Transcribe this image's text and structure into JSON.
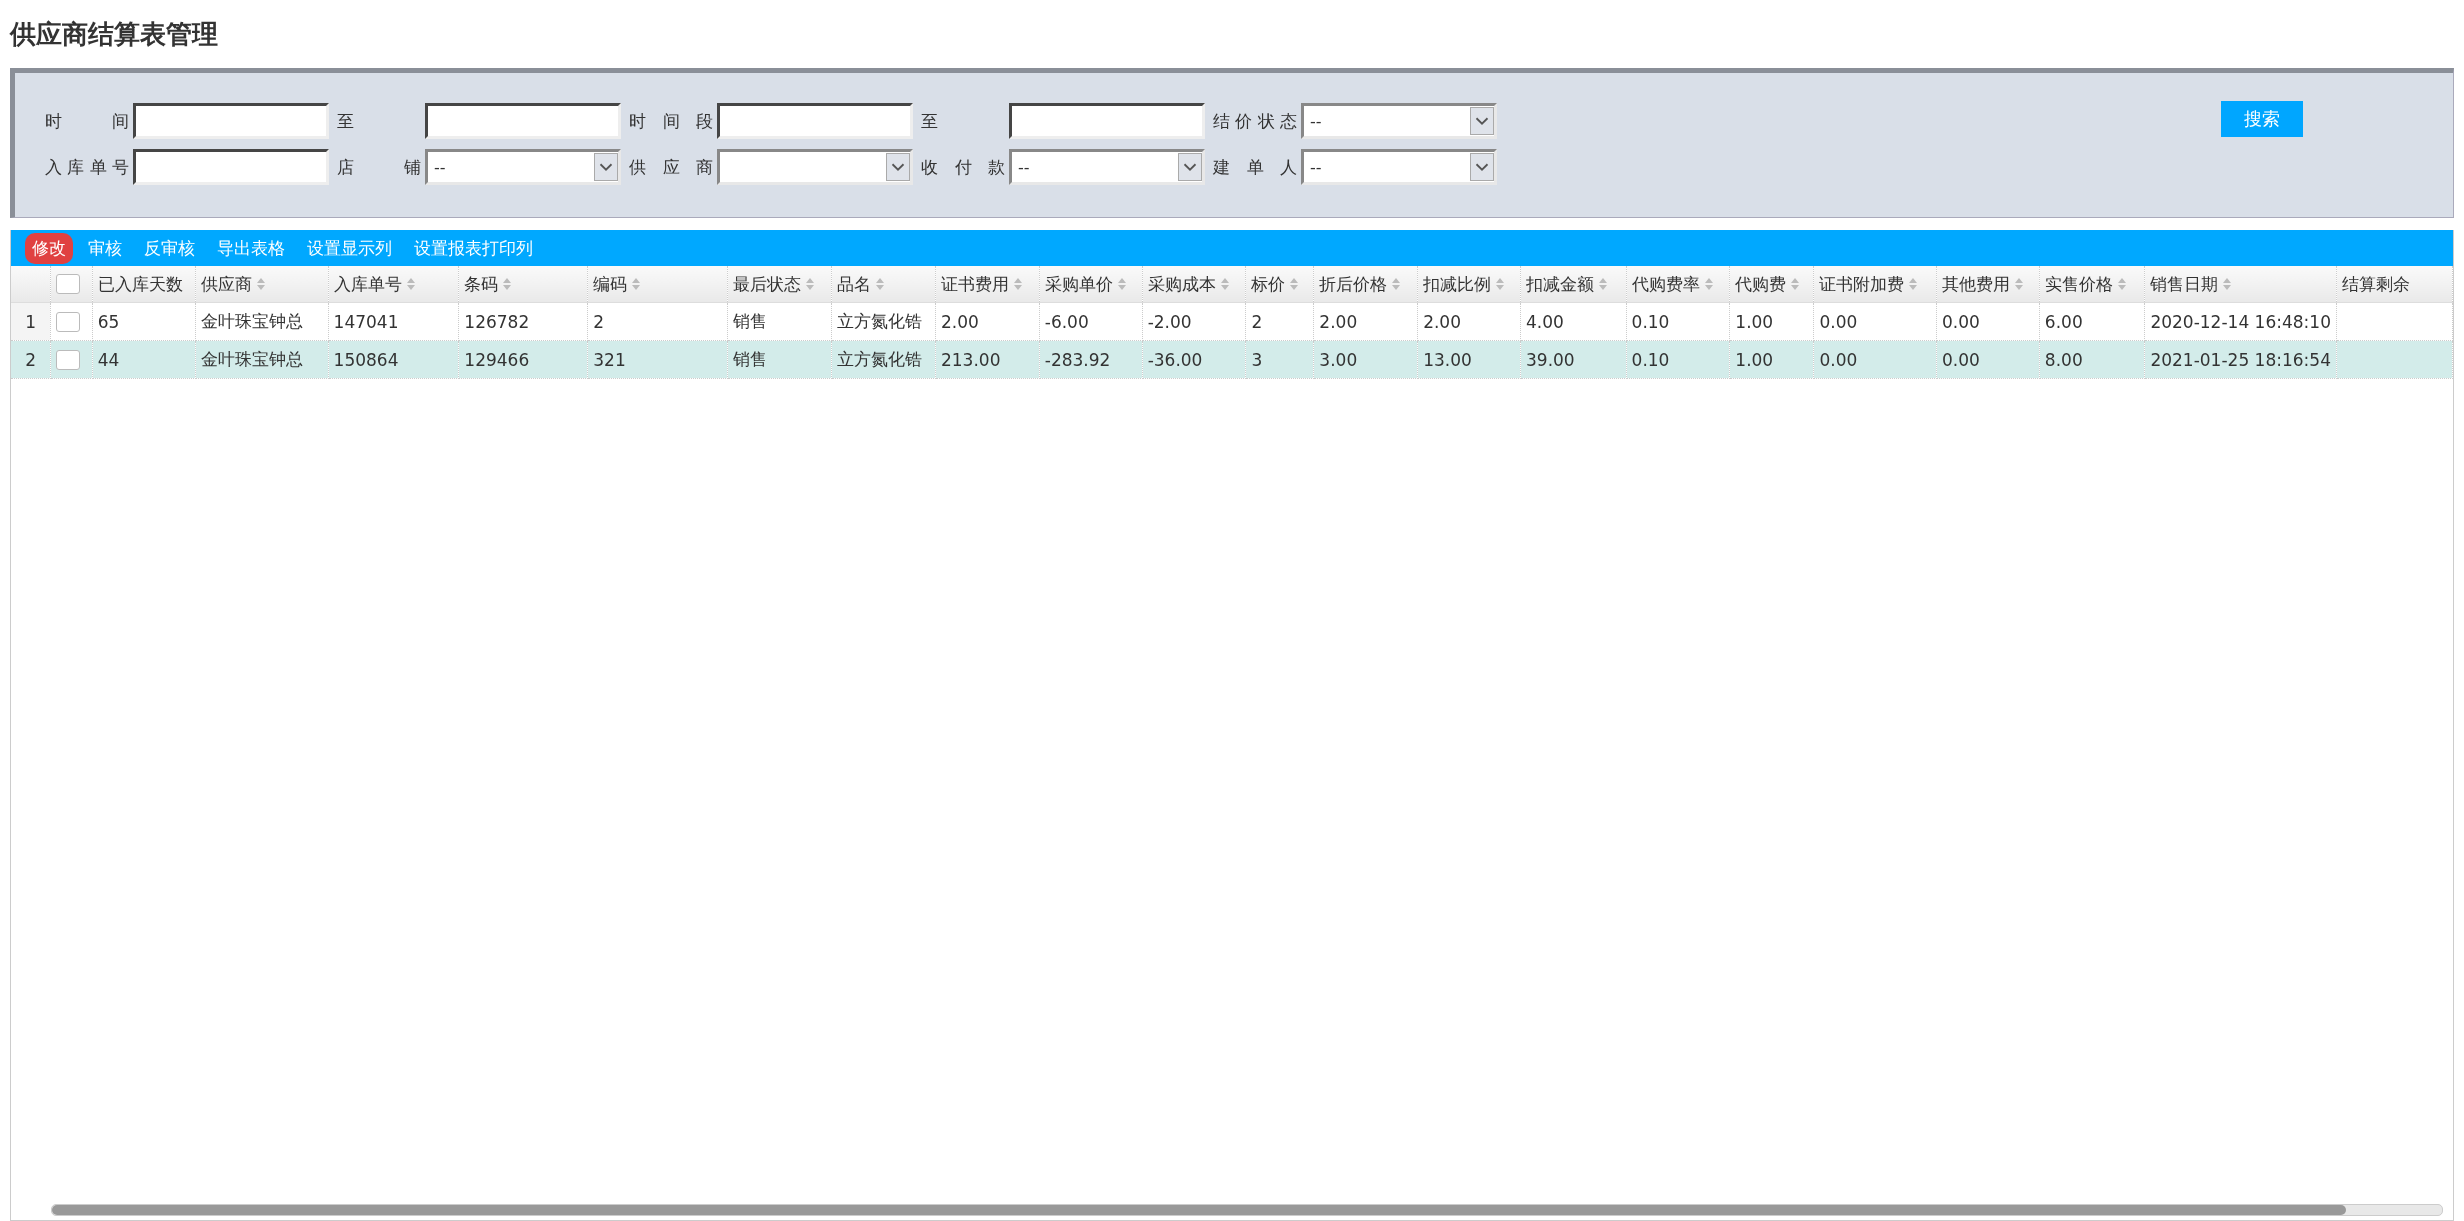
{
  "title": "供应商结算表管理",
  "filter_rows": [
    {
      "fields": [
        {
          "label": "时间",
          "kind": "input"
        },
        {
          "label": "至",
          "kind": "input"
        },
        {
          "label": "时间段",
          "kind": "input"
        },
        {
          "label": "至",
          "kind": "input"
        },
        {
          "label": "结价状态",
          "kind": "select",
          "value": "--"
        }
      ]
    },
    {
      "fields": [
        {
          "label": "入库单号",
          "kind": "input"
        },
        {
          "label": "店铺",
          "kind": "select",
          "value": "--"
        },
        {
          "label": "供应商",
          "kind": "select"
        },
        {
          "label": "收付款",
          "kind": "select",
          "value": "--"
        },
        {
          "label": "建单人",
          "kind": "select",
          "value": "--"
        }
      ]
    }
  ],
  "search_button": "搜索",
  "toolbar": [
    {
      "label": "修改",
      "selected": true
    },
    {
      "label": "审核",
      "selected": false
    },
    {
      "label": "反审核",
      "selected": false
    },
    {
      "label": "导出表格",
      "selected": false
    },
    {
      "label": "设置显示列",
      "selected": false
    },
    {
      "label": "设置报表打印列",
      "selected": false
    }
  ],
  "table": {
    "all_checked": false,
    "columns": [
      {
        "label": "已入库天数",
        "sortable": false
      },
      {
        "label": "供应商",
        "sortable": true
      },
      {
        "label": "入库单号",
        "sortable": true
      },
      {
        "label": "条码",
        "sortable": true
      },
      {
        "label": "编码",
        "sortable": true
      },
      {
        "label": "最后状态",
        "sortable": true
      },
      {
        "label": "品名",
        "sortable": true
      },
      {
        "label": "证书费用",
        "sortable": true
      },
      {
        "label": "采购单价",
        "sortable": true
      },
      {
        "label": "采购成本",
        "sortable": true
      },
      {
        "label": "标价",
        "sortable": true
      },
      {
        "label": "折后价格",
        "sortable": true
      },
      {
        "label": "扣减比例",
        "sortable": true
      },
      {
        "label": "扣减金额",
        "sortable": true
      },
      {
        "label": "代购费率",
        "sortable": true
      },
      {
        "label": "代购费",
        "sortable": true
      },
      {
        "label": "证书附加费",
        "sortable": true
      },
      {
        "label": "其他费用",
        "sortable": true
      },
      {
        "label": "实售价格",
        "sortable": true
      },
      {
        "label": "销售日期",
        "sortable": true
      },
      {
        "label": "结算剩余",
        "sortable": false
      }
    ],
    "rows": [
      {
        "number": "1",
        "selected": false,
        "checked": false,
        "cells": [
          "65",
          "金叶珠宝钟总",
          "147041",
          "126782",
          "2",
          "销售",
          "立方氮化锆",
          "2.00",
          "-6.00",
          "-2.00",
          "2",
          "2.00",
          "2.00",
          "4.00",
          "0.10",
          "1.00",
          "0.00",
          "0.00",
          "6.00",
          "2020-12-14 16:48:10",
          ""
        ]
      },
      {
        "number": "2",
        "selected": true,
        "checked": false,
        "cells": [
          "44",
          "金叶珠宝钟总",
          "150864",
          "129466",
          "321",
          "销售",
          "立方氮化锆",
          "213.00",
          "-283.92",
          "-36.00",
          "3",
          "3.00",
          "13.00",
          "39.00",
          "0.10",
          "1.00",
          "0.00",
          "0.00",
          "8.00",
          "2021-01-25 18:16:54",
          ""
        ]
      }
    ]
  }
}
